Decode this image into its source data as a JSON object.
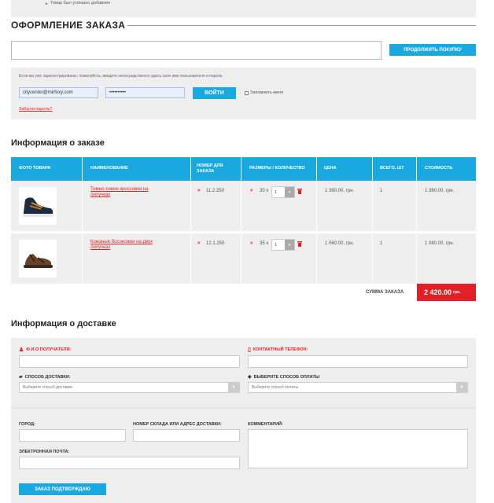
{
  "notice": {
    "text": "Товар был успешно добавлен"
  },
  "checkout": {
    "title": "ОФОРМЛЕНИЕ ЗАКАЗА",
    "continue_label": "ПРОДОЛЖИТЬ ПОКУПКУ"
  },
  "login": {
    "info": "Если вы уже зарегистрированы, пожалуйста, введите непосредственно здесь свое имя пользователя и пароль",
    "email_value": "citycenter@mirfoxy.com",
    "password_value": "••••••••••",
    "button_label": "ВОЙТИ",
    "remember_label": "Запомнить меня",
    "forgot_label": "Забыли пароль?"
  },
  "order": {
    "title": "Информация о заказе",
    "columns": [
      "ФОТО ТОВАРА",
      "НАИМЕНОВАНИЕ",
      "НОМЕР ДЛЯ ЗАКАЗА",
      "РАЗМЕРЫ / КОЛИЧЕСТВО",
      "ЦЕНА",
      "ВСЕГО, ШТ",
      "СТОИМОСТЬ"
    ],
    "rows": [
      {
        "name": "Темно-синие кроссовки на липучках",
        "code": "11.2.250",
        "size": "30 x",
        "qty": "1",
        "price": "1 360.00, грн.",
        "count": "1",
        "total": "1 360.00, грн."
      },
      {
        "name": "Кожаные босоножки на двух липучках",
        "code": "12.1.250",
        "size": "35 x",
        "qty": "1",
        "price": "1 060.00, грн.",
        "count": "1",
        "total": "1 060.00, грн."
      }
    ],
    "sum_label": "СУММА ЗАКАЗА",
    "sum_value": "2 420.00",
    "sum_currency": "грн."
  },
  "delivery": {
    "title": "Информация о доставке",
    "recipient_label": "Ф.И.О ПОЛУЧАТЕЛЯ:",
    "phone_label": "КОНТАКТНЫЙ ТЕЛЕФОН:",
    "method_label": "СПОСОБ ДОСТАВКИ:",
    "method_placeholder": "Выберите способ доставки",
    "payment_label": "ВЫБЕРИТЕ СПОСОБ ОПЛАТЫ",
    "payment_placeholder": "Выберите способ оплаты",
    "city_label": "ГОРОД:",
    "warehouse_label": "НОМЕР СКЛАДА ИЛИ АДРЕС ДОСТАВКИ:",
    "comment_label": "КОММЕНТАРИЙ:",
    "email_label": "ЭЛЕКТРОННАЯ ПОЧТА:",
    "submit_label": "ЗАКАЗ ПОДТВЕРЖДАЮ"
  },
  "colors": {
    "accent": "#1aa8e0",
    "red": "#e31e24",
    "panel": "#eeeeee"
  }
}
